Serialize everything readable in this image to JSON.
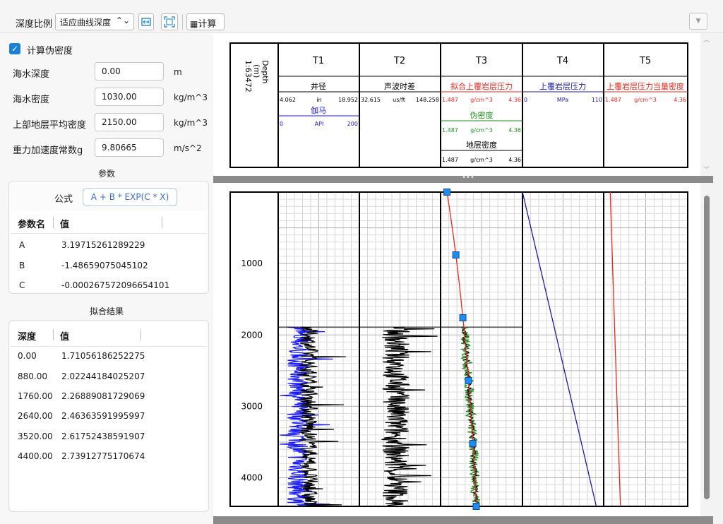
{
  "toolbar": {
    "scale_label": "深度比例",
    "scale_value": "适应曲线深度",
    "calc_label": "计算",
    "fit_width_icon": "fit-width-icon",
    "fit_all_icon": "fit-all-icon",
    "menu_icon": "triangle-down-icon"
  },
  "params": {
    "calc_pseudo_label": "计算伪密度",
    "calc_pseudo_checked": true,
    "rows": [
      {
        "label": "海水深度",
        "value": "0.00",
        "unit": "m"
      },
      {
        "label": "海水密度",
        "value": "1030.00",
        "unit": "kg/m^3"
      },
      {
        "label": "上部地层平均密度",
        "value": "2150.00",
        "unit": "kg/m^3"
      },
      {
        "label": "重力加速度常数g",
        "value": "9.80665",
        "unit": "m/s^2"
      }
    ]
  },
  "coef": {
    "title": "参数",
    "formula_label": "公式",
    "formula": "A + B * EXP(C * X)",
    "col_name": "参数名",
    "col_value": "值",
    "rows": [
      {
        "name": "A",
        "value": "3.19715261289229"
      },
      {
        "name": "B",
        "value": "-1.48659075045102"
      },
      {
        "name": "C",
        "value": "-0.000267572096654101"
      }
    ]
  },
  "fit": {
    "title": "拟合结果",
    "col_depth": "深度",
    "col_value": "值",
    "rows": [
      {
        "depth": "0.00",
        "value": "1.71056186252275"
      },
      {
        "depth": "880.00",
        "value": "2.02244184025207"
      },
      {
        "depth": "1760.00",
        "value": "2.26889081729069"
      },
      {
        "depth": "2640.00",
        "value": "2.46363591995997"
      },
      {
        "depth": "3520.00",
        "value": "2.61752438591907"
      },
      {
        "depth": "4400.00",
        "value": "2.73912775170674"
      }
    ]
  },
  "header": {
    "depth_title": "Depth",
    "depth_unit": "(m)",
    "depth_scale": "1:63472",
    "tracks": [
      "T1",
      "T2",
      "T3",
      "T4",
      "T5"
    ],
    "curves": {
      "t1_a": {
        "name": "井径",
        "min": "4.062",
        "unit": "in",
        "max": "18.952",
        "color": "#000000"
      },
      "t1_b": {
        "name": "伽马",
        "min": "0",
        "unit": "API",
        "max": "200",
        "color": "#1a1aff"
      },
      "t2_a": {
        "name": "声波时差",
        "min": "32.615",
        "unit": "us/ft",
        "max": "148.258",
        "color": "#000000"
      },
      "t3_a": {
        "name": "拟合上覆岩层压力",
        "min": "1.487",
        "unit": "g/cm^3",
        "max": "4.36",
        "color": "#e8281e"
      },
      "t3_b": {
        "name": "伪密度",
        "min": "1.487",
        "unit": "g/cm^3",
        "max": "4.36",
        "color": "#1e8c1e"
      },
      "t3_c": {
        "name": "地层密度",
        "min": "1.487",
        "unit": "g/cm^3",
        "max": "4.36",
        "color": "#000000"
      },
      "t4_a": {
        "name": "上覆岩层压力",
        "min": "0",
        "unit": "MPa",
        "max": "110",
        "color": "#1a1aa0"
      },
      "t5_a": {
        "name": "上覆岩层压力当量密度",
        "min": "1.487",
        "unit": "g/cm^3",
        "max": "4.36",
        "color": "#e8281e"
      }
    }
  },
  "depth_axis": {
    "ticks": [
      "1000",
      "2000",
      "3000",
      "4000"
    ],
    "tick_values": [
      1000,
      2000,
      3000,
      4000
    ],
    "top": 0,
    "bottom": 4400
  },
  "chart_data": {
    "type": "line",
    "y_axis": "Depth (m)",
    "ylim": [
      0,
      4400
    ],
    "series": [
      {
        "name": "拟合上覆岩层压力",
        "track": "T3",
        "x": [
          1.71056186252275,
          2.02244184025207,
          2.26889081729069,
          2.46363591995997,
          2.61752438591907,
          2.73912775170674
        ],
        "depth": [
          0,
          880,
          1760,
          2640,
          3520,
          4400
        ],
        "color": "#e8281e"
      },
      {
        "name": "上覆岩层压力",
        "track": "T4",
        "xlim": [
          0,
          110
        ],
        "x": [
          0,
          100
        ],
        "depth": [
          0,
          4400
        ],
        "color": "#1a1aa0"
      },
      {
        "name": "上覆岩层压力当量密度",
        "track": "T5",
        "xlim": [
          1.487,
          4.36
        ],
        "x": [
          1.71,
          2.06
        ],
        "depth": [
          0,
          4400
        ],
        "color": "#e8281e"
      }
    ]
  }
}
